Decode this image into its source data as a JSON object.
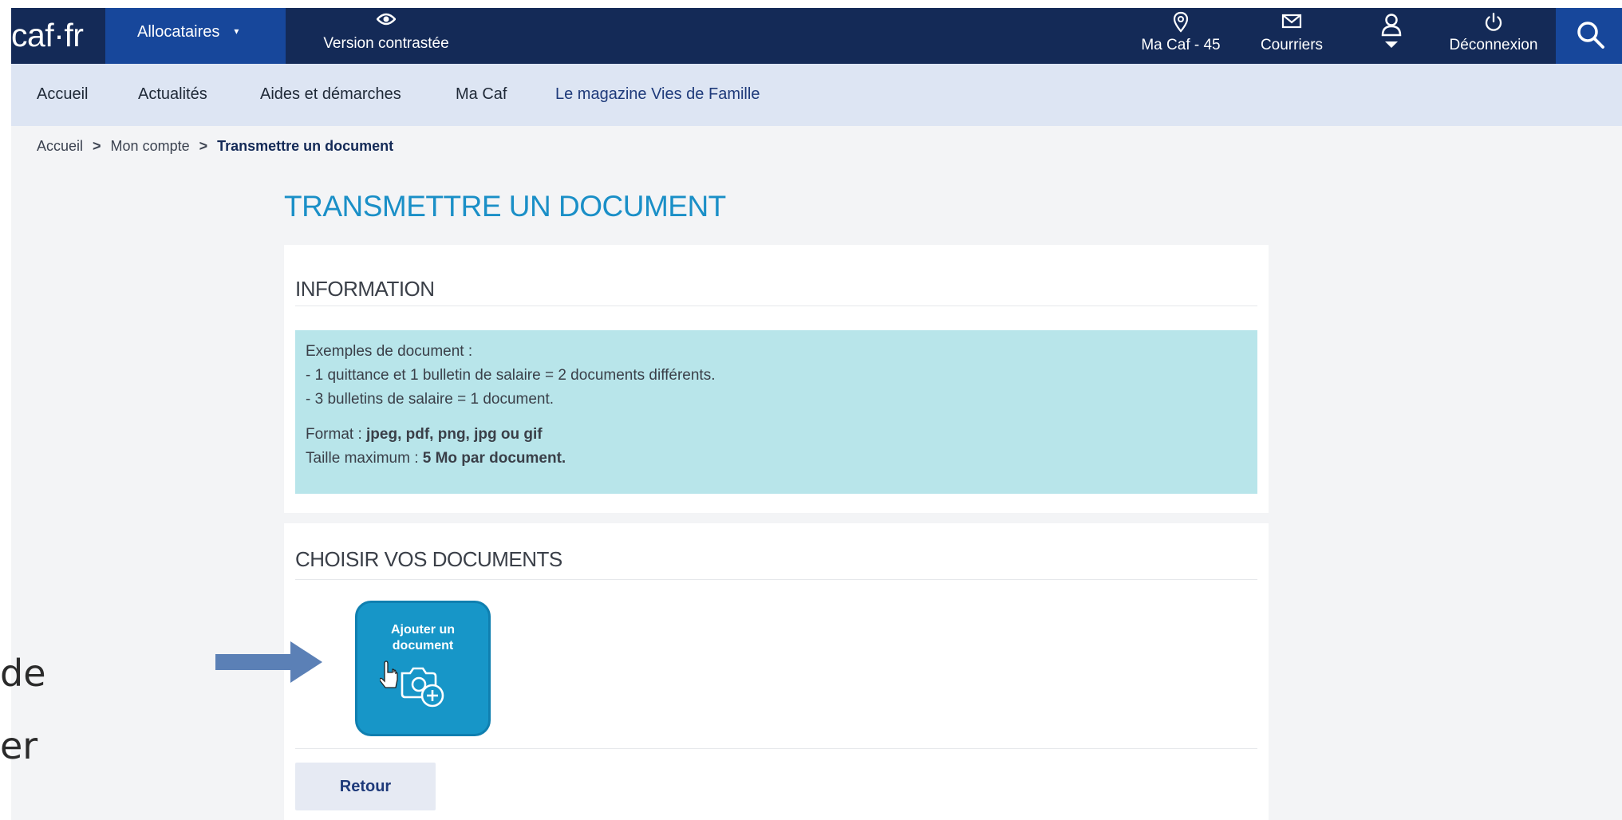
{
  "header": {
    "logo": "caf·fr",
    "audience_menu": {
      "label": "Allocataires",
      "caret": "▾"
    },
    "contrast": {
      "label": "Version contrastée"
    },
    "items": [
      {
        "label": "Ma Caf - 45"
      },
      {
        "label": "Courriers"
      },
      {
        "label": ""
      },
      {
        "label": "Déconnexion"
      }
    ]
  },
  "nav": {
    "items": [
      "Accueil",
      "Actualités",
      "Aides et démarches",
      "Ma Caf",
      "Le magazine Vies de Famille"
    ]
  },
  "breadcrumb": {
    "items": [
      "Accueil",
      "Mon compte",
      "Transmettre un document"
    ],
    "separator": ">"
  },
  "page": {
    "title": "TRANSMETTRE UN DOCUMENT"
  },
  "information": {
    "title": "INFORMATION",
    "examples_intro": "Exemples de document :",
    "example_1": "- 1 quittance et 1 bulletin de salaire = 2 documents différents.",
    "example_2": "- 3 bulletins de salaire = 1 document.",
    "format_label": "Format : ",
    "format_value": "jpeg, pdf, png, jpg ou gif",
    "size_label": "Taille maximum : ",
    "size_value": "5 Mo par document."
  },
  "documents": {
    "title": "CHOISIR VOS DOCUMENTS",
    "add_button_line1": "Ajouter un",
    "add_button_line2": "document",
    "back_button": "Retour"
  },
  "slide_overlay": {
    "fragment_1": "de",
    "fragment_2": "er"
  },
  "colors": {
    "navbar": "#142a57",
    "accent_blue": "#17479b",
    "subnav_bg": "#dde5f3",
    "title_blue": "#1a8fc7",
    "info_bg": "#b8e5ea",
    "add_button": "#1796c8",
    "annotation_arrow": "#5b80b6"
  }
}
